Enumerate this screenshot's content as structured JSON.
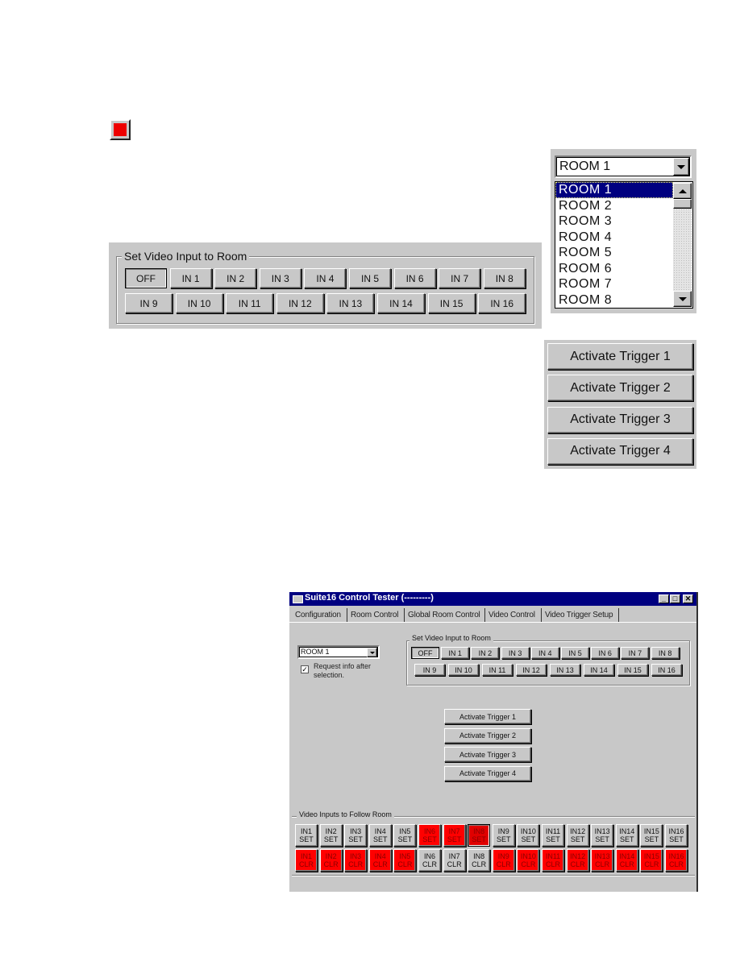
{
  "indicator": {
    "icon": "red-square-indicator",
    "color": "#ee0000"
  },
  "large_video_input": {
    "legend": "Set Video Input to Room",
    "row1": [
      "OFF",
      "IN 1",
      "IN 2",
      "IN 3",
      "IN 4",
      "IN 5",
      "IN 6",
      "IN 7",
      "IN 8"
    ],
    "row2": [
      "IN 9",
      "IN 10",
      "IN 11",
      "IN 12",
      "IN 13",
      "IN 14",
      "IN 15",
      "IN 16"
    ],
    "pressed": "OFF"
  },
  "large_room_combo": {
    "value": "ROOM 1",
    "options": [
      "ROOM 1",
      "ROOM 2",
      "ROOM 3",
      "ROOM 4",
      "ROOM 5",
      "ROOM 6",
      "ROOM 7",
      "ROOM 8"
    ],
    "selected_index": 0
  },
  "large_triggers": [
    "Activate Trigger 1",
    "Activate Trigger 2",
    "Activate Trigger 3",
    "Activate Trigger 4"
  ],
  "window": {
    "title": "Suite16 Control Tester (---------)",
    "caption_buttons": {
      "minimize": "_",
      "maximize": "□",
      "close": "✕"
    },
    "tabs": [
      "Configuration",
      "Room Control",
      "Global Room Control",
      "Video Control",
      "Video Trigger Setup"
    ],
    "active_tab": "Video Control",
    "room_combo_value": "ROOM 1",
    "request_info_label_line1": "Request info after",
    "request_info_label_line2": "selection.",
    "request_info_checked": true,
    "video_input_legend": "Set Video Input to Room",
    "video_row1": [
      "OFF",
      "IN 1",
      "IN 2",
      "IN 3",
      "IN 4",
      "IN 5",
      "IN 6",
      "IN 7",
      "IN 8"
    ],
    "video_row2": [
      "IN 9",
      "IN 10",
      "IN 11",
      "IN 12",
      "IN 13",
      "IN 14",
      "IN 15",
      "IN 16"
    ],
    "triggers": [
      "Activate Trigger 1",
      "Activate Trigger 2",
      "Activate Trigger 3",
      "Activate Trigger 4"
    ],
    "follow_legend": "Video Inputs to Follow Room",
    "set_buttons": [
      {
        "top": "IN1",
        "bottom": "SET",
        "active": false
      },
      {
        "top": "IN2",
        "bottom": "SET",
        "active": false
      },
      {
        "top": "IN3",
        "bottom": "SET",
        "active": false
      },
      {
        "top": "IN4",
        "bottom": "SET",
        "active": false
      },
      {
        "top": "IN5",
        "bottom": "SET",
        "active": false
      },
      {
        "top": "IN6",
        "bottom": "SET",
        "active": true
      },
      {
        "top": "IN7",
        "bottom": "SET",
        "active": true
      },
      {
        "top": "IN8",
        "bottom": "SET",
        "active": true
      },
      {
        "top": "IN9",
        "bottom": "SET",
        "active": false
      },
      {
        "top": "IN10",
        "bottom": "SET",
        "active": false
      },
      {
        "top": "IN11",
        "bottom": "SET",
        "active": false
      },
      {
        "top": "IN12",
        "bottom": "SET",
        "active": false
      },
      {
        "top": "IN13",
        "bottom": "SET",
        "active": false
      },
      {
        "top": "IN14",
        "bottom": "SET",
        "active": false
      },
      {
        "top": "IN15",
        "bottom": "SET",
        "active": false
      },
      {
        "top": "IN16",
        "bottom": "SET",
        "active": false
      }
    ],
    "clr_buttons": [
      {
        "top": "IN1",
        "bottom": "CLR",
        "active": true
      },
      {
        "top": "IN2",
        "bottom": "CLR",
        "active": true
      },
      {
        "top": "IN3",
        "bottom": "CLR",
        "active": true
      },
      {
        "top": "IN4",
        "bottom": "CLR",
        "active": true
      },
      {
        "top": "IN5",
        "bottom": "CLR",
        "active": true
      },
      {
        "top": "IN6",
        "bottom": "CLR",
        "active": false
      },
      {
        "top": "IN7",
        "bottom": "CLR",
        "active": false
      },
      {
        "top": "IN8",
        "bottom": "CLR",
        "active": false
      },
      {
        "top": "IN9",
        "bottom": "CLR",
        "active": true
      },
      {
        "top": "IN10",
        "bottom": "CLR",
        "active": true
      },
      {
        "top": "IN11",
        "bottom": "CLR",
        "active": true
      },
      {
        "top": "IN12",
        "bottom": "CLR",
        "active": true
      },
      {
        "top": "IN13",
        "bottom": "CLR",
        "active": true
      },
      {
        "top": "IN14",
        "bottom": "CLR",
        "active": true
      },
      {
        "top": "IN15",
        "bottom": "CLR",
        "active": true
      },
      {
        "top": "IN16",
        "bottom": "CLR",
        "active": true
      }
    ],
    "pressed_set": "IN8",
    "colors": {
      "active_red": "#ff0000",
      "title_bar": "#000080",
      "face": "#c8c8c8"
    }
  }
}
